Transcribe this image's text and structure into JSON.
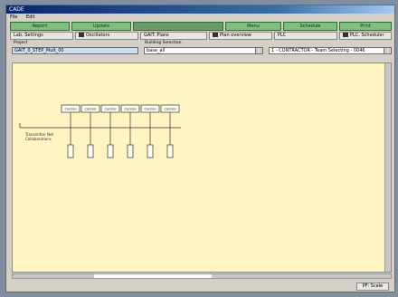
{
  "window": {
    "title": "CADE"
  },
  "menu": [
    "File",
    "Edit"
  ],
  "top_buttons": [
    "Report",
    "Update",
    "",
    "Menu",
    "Schedule",
    "Print"
  ],
  "tabs": [
    "Lab. Settings",
    "Oscillators",
    "GAIT. Plans",
    "Plan overview",
    "PLC",
    "PLC. Scheduler"
  ],
  "project": {
    "label": "Project",
    "value": "GAIT_0_STEP_Mult_00"
  },
  "building": {
    "label": "Building Selection",
    "value": "base_all"
  },
  "right_field": {
    "value": "1 - CONTRACTOR - Team Selecting - 0046"
  },
  "diagram": {
    "side_label_1": "Transmitter Net",
    "side_label_2": "Collaborations",
    "nodes": [
      "Control",
      "Control",
      "Control",
      "Control",
      "Control",
      "Control"
    ]
  },
  "status_button": "PF: Scale"
}
